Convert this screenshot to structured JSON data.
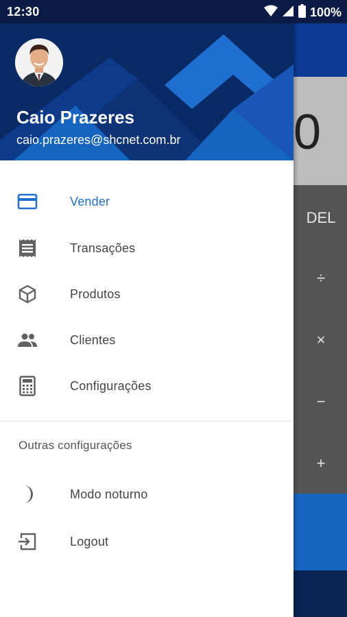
{
  "status_bar": {
    "time": "12:30",
    "battery": "100%"
  },
  "background": {
    "display_value": "0",
    "ops": [
      "DEL",
      "÷",
      "×",
      "−",
      "+"
    ]
  },
  "drawer": {
    "user": {
      "name": "Caio Prazeres",
      "email": "caio.prazeres@shcnet.com.br"
    },
    "menu": [
      {
        "label": "Vender",
        "icon": "credit-card-icon",
        "active": true
      },
      {
        "label": "Transações",
        "icon": "receipt-icon",
        "active": false
      },
      {
        "label": "Produtos",
        "icon": "box-icon",
        "active": false
      },
      {
        "label": "Clientes",
        "icon": "people-icon",
        "active": false
      },
      {
        "label": "Configurações",
        "icon": "calculator-icon",
        "active": false
      }
    ],
    "section_title": "Outras configurações",
    "other_menu": [
      {
        "label": "Modo noturno",
        "icon": "moon-icon"
      },
      {
        "label": "Logout",
        "icon": "logout-icon"
      }
    ]
  },
  "colors": {
    "header_bg": "#0a2a66",
    "accent": "#1e6fd0",
    "icon_gray": "#616161"
  }
}
